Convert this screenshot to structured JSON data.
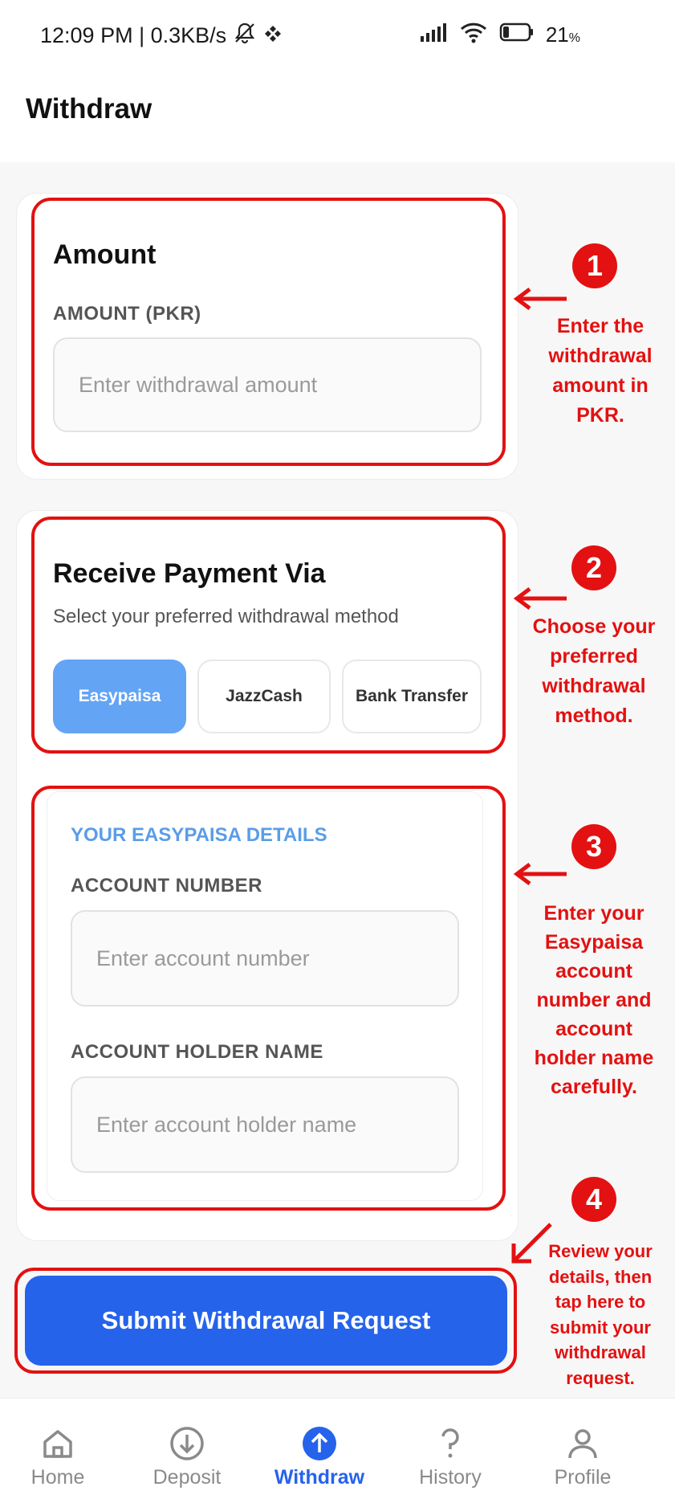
{
  "status_bar": {
    "time_speed": "12:09 PM | 0.3KB/s",
    "battery": "21",
    "battery_unit": "%",
    "icons": [
      "mute-notification-icon",
      "app-icon",
      "signal-icon",
      "wifi-icon",
      "battery-icon"
    ]
  },
  "header": {
    "title": "Withdraw"
  },
  "amount_section": {
    "title": "Amount",
    "label": "AMOUNT (PKR)",
    "placeholder": "Enter withdrawal amount"
  },
  "payment_section": {
    "title": "Receive Payment Via",
    "subtitle": "Select your preferred withdrawal method",
    "methods": [
      {
        "label": "Easypaisa",
        "selected": true
      },
      {
        "label": "JazzCash",
        "selected": false
      },
      {
        "label": "Bank Transfer",
        "selected": false
      }
    ]
  },
  "details_section": {
    "title": "YOUR EASYPAISA DETAILS",
    "account_number_label": "ACCOUNT NUMBER",
    "account_number_placeholder": "Enter account number",
    "holder_name_label": "ACCOUNT HOLDER NAME",
    "holder_name_placeholder": "Enter account holder name"
  },
  "submit": {
    "label": "Submit Withdrawal Request"
  },
  "annotations": [
    {
      "number": "1",
      "lines": [
        "Enter the",
        "withdrawal",
        "amount in",
        "PKR."
      ]
    },
    {
      "number": "2",
      "lines": [
        "Choose your",
        "preferred",
        "withdrawal",
        "method."
      ]
    },
    {
      "number": "3",
      "lines": [
        "Enter your",
        "Easypaisa",
        "account",
        "number and",
        "account",
        "holder name",
        "carefully."
      ]
    },
    {
      "number": "4",
      "lines": [
        "Review your",
        "details, then",
        "tap here to",
        "submit your",
        "withdrawal",
        "request."
      ]
    }
  ],
  "bottom_nav": {
    "items": [
      {
        "label": "Home",
        "icon": "home-icon",
        "active": false
      },
      {
        "label": "Deposit",
        "icon": "deposit-icon",
        "active": false
      },
      {
        "label": "Withdraw",
        "icon": "withdraw-icon",
        "active": true
      },
      {
        "label": "History",
        "icon": "history-icon",
        "active": false
      },
      {
        "label": "Profile",
        "icon": "profile-icon",
        "active": false
      }
    ]
  },
  "colors": {
    "primary": "#2563eb",
    "selected_method": "#63a4f4",
    "annotation": "#e31111",
    "details_title": "#5a9de8"
  }
}
